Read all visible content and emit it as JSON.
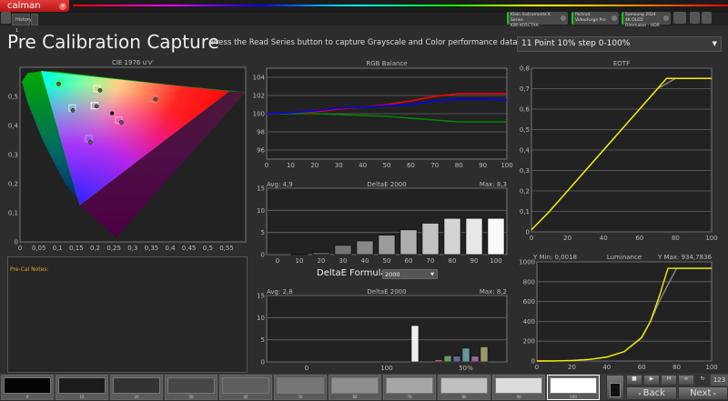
{
  "app": {
    "logo": "calman",
    "history_tab": "History 1"
  },
  "devices": [
    {
      "line1": "Klein Instruments K Series",
      "line2": "K80 K05CTXA"
    },
    {
      "line1": "Portrait VideoForge Pro",
      "line2": ""
    },
    {
      "line1": "Samsung 2024 4K OLED",
      "line2": "Filmmaker - HDR"
    }
  ],
  "page": {
    "title": "Pre Calibration Capture",
    "instruction": "Press the Read Series button to capture Grayscale and Color performance data pre-calibration.",
    "series_select": "11 Point 10% step 0-100%"
  },
  "notes": {
    "label": "Pre-Cal Notes:"
  },
  "deltae_formula": {
    "label": "DeltaE Formula",
    "value": "2000"
  },
  "colors": {
    "accent": "#d42020",
    "yellow": "#f0f000"
  },
  "chart_data": [
    {
      "id": "cie",
      "type": "scatter",
      "title": "CIE 1976 u'v'",
      "xlim": [
        0,
        0.6
      ],
      "ylim": [
        0,
        0.6
      ],
      "xticks": [
        "0",
        "0,05",
        "0,1",
        "0,15",
        "0,2",
        "0,25",
        "0,3",
        "0,35",
        "0,4",
        "0,45",
        "0,5",
        "0,55"
      ],
      "yticks": [
        "0",
        "0,1",
        "0,2",
        "0,3",
        "0,4",
        "0,5"
      ],
      "gamut": {
        "red": [
          0.557,
          0.517
        ],
        "green": [
          0.056,
          0.587
        ],
        "blue": [
          0.159,
          0.126
        ]
      },
      "points": [
        {
          "name": "green",
          "target": [
            0.105,
            0.545
          ],
          "measured": [
            0.103,
            0.543
          ],
          "color": "#44ff44"
        },
        {
          "name": "yellow",
          "target": [
            0.205,
            0.527
          ],
          "measured": [
            0.213,
            0.521
          ],
          "color": "#ffffaa"
        },
        {
          "name": "red",
          "target": [
            0.355,
            0.492
          ],
          "measured": [
            0.361,
            0.49
          ],
          "color": "#ff8888"
        },
        {
          "name": "cyan",
          "target": [
            0.139,
            0.46
          ],
          "measured": [
            0.141,
            0.452
          ],
          "color": "#aaffff"
        },
        {
          "name": "white",
          "target": [
            0.198,
            0.468
          ],
          "measured": [
            0.204,
            0.466
          ],
          "color": "#ffffff"
        },
        {
          "name": "magenta",
          "target": [
            0.263,
            0.418
          ],
          "measured": [
            0.27,
            0.411
          ],
          "color": "#ffaaff"
        },
        {
          "name": "blue",
          "target": [
            0.183,
            0.355
          ],
          "measured": [
            0.187,
            0.343
          ],
          "color": "#aaaaff"
        }
      ],
      "black_point": [
        0.245,
        0.442
      ]
    },
    {
      "id": "rgb",
      "type": "line",
      "title": "RGB Balance",
      "xlim": [
        0,
        100
      ],
      "ylim": [
        95,
        105
      ],
      "x": [
        0,
        10,
        20,
        30,
        40,
        50,
        60,
        70,
        80,
        90,
        100
      ],
      "yticks": [
        "96",
        "98",
        "100",
        "102",
        "104"
      ],
      "series": [
        {
          "color": "#008800",
          "values": [
            100,
            100,
            100,
            99.9,
            99.8,
            99.7,
            99.5,
            99.3,
            99.1,
            99.1,
            99.1
          ]
        },
        {
          "color": "#ff0000",
          "values": [
            100,
            100.1,
            100.2,
            100.5,
            100.7,
            101,
            101.4,
            101.9,
            102.2,
            102.2,
            102.2
          ]
        },
        {
          "color": "#0000ff",
          "values": [
            100,
            100.1,
            100.3,
            100.6,
            100.7,
            100.9,
            101,
            101.4,
            101.6,
            101.6,
            101.5
          ]
        }
      ]
    },
    {
      "id": "de_gray",
      "type": "bar",
      "title": "DeltaE 2000",
      "avg": "Avg: 4,9",
      "max": "Max: 8,3",
      "ylim": [
        0,
        15
      ],
      "categories": [
        "0",
        "10",
        "20",
        "30",
        "40",
        "50",
        "60",
        "70",
        "80",
        "90",
        "100"
      ],
      "values": [
        0,
        0.1,
        0.5,
        2.1,
        3.1,
        4.4,
        5.6,
        7.1,
        8.2,
        8.2,
        8.2
      ],
      "yticks": [
        "0",
        "5",
        "10",
        "15"
      ]
    },
    {
      "id": "de_color",
      "type": "bar",
      "title": "DeltaE 2000",
      "avg": "Avg: 2,8",
      "max": "Max: 8,2",
      "ylim": [
        0,
        15
      ],
      "categories": [
        "0",
        "100",
        "50%"
      ],
      "yticks": [
        "0",
        "5",
        "10",
        "15"
      ],
      "bars": [
        {
          "group": "100",
          "color": "#eeeeee",
          "value": 8.2
        },
        {
          "group": "50%",
          "color": "#aa6677",
          "value": 0.5
        },
        {
          "group": "50%",
          "color": "#669966",
          "value": 1.4
        },
        {
          "group": "50%",
          "color": "#666699",
          "value": 1.3
        },
        {
          "group": "50%",
          "color": "#669999",
          "value": 3.1
        },
        {
          "group": "50%",
          "color": "#996699",
          "value": 1.3
        },
        {
          "group": "50%",
          "color": "#999966",
          "value": 3.4
        }
      ]
    },
    {
      "id": "eotf",
      "type": "line",
      "title": "EOTF",
      "xlim": [
        0,
        100
      ],
      "ylim": [
        0,
        0.8
      ],
      "x": [
        0,
        10,
        20,
        30,
        40,
        50,
        60,
        70,
        75,
        80,
        90,
        100
      ],
      "xticks": [
        "0",
        "20",
        "40",
        "60",
        "80",
        "100"
      ],
      "yticks": [
        "0",
        "0,1",
        "0,2",
        "0,3",
        "0,4",
        "0,5",
        "0,6",
        "0,7",
        "0,8"
      ],
      "series": [
        {
          "color": "#888888",
          "values": [
            0.01,
            0.1,
            0.2,
            0.3,
            0.4,
            0.5,
            0.6,
            0.7,
            0.725,
            0.75,
            0.75,
            0.75
          ]
        },
        {
          "color": "#f0f000",
          "values": [
            0.01,
            0.1,
            0.2,
            0.3,
            0.4,
            0.5,
            0.6,
            0.7,
            0.75,
            0.75,
            0.75,
            0.75
          ]
        }
      ]
    },
    {
      "id": "lum",
      "type": "line",
      "title": "Luminance",
      "ymin_label": "Y Min: 0,0018",
      "ymax_label": "Y Max: 934,7836",
      "xlim": [
        0,
        100
      ],
      "ylim": [
        0,
        1000
      ],
      "x": [
        0,
        10,
        20,
        30,
        40,
        50,
        60,
        65,
        70,
        75,
        80,
        90,
        100
      ],
      "xticks": [
        "0",
        "20",
        "40",
        "60",
        "80",
        "100"
      ],
      "yticks": [
        "0",
        "200",
        "400",
        "600",
        "800",
        "1000"
      ],
      "series": [
        {
          "color": "#888888",
          "values": [
            0,
            1,
            5,
            15,
            40,
            95,
            240,
            400,
            600,
            770,
            935,
            935,
            935
          ]
        },
        {
          "color": "#f0f000",
          "values": [
            0,
            1,
            5,
            15,
            40,
            95,
            235,
            400,
            650,
            935,
            935,
            935,
            935
          ]
        }
      ]
    }
  ],
  "swatches": [
    {
      "label": "0",
      "color": "#050505"
    },
    {
      "label": "10",
      "color": "#1c1c1c"
    },
    {
      "label": "20",
      "color": "#333"
    },
    {
      "label": "30",
      "color": "#474747"
    },
    {
      "label": "40",
      "color": "#5e5e5e"
    },
    {
      "label": "50",
      "color": "#767676"
    },
    {
      "label": "60",
      "color": "#8e8e8e"
    },
    {
      "label": "70",
      "color": "#a6a6a6"
    },
    {
      "label": "80",
      "color": "#c0c0c0"
    },
    {
      "label": "90",
      "color": "#dcdcdc"
    },
    {
      "label": "100",
      "color": "#ffffff"
    }
  ],
  "nav": {
    "back": "Back",
    "next": "Next",
    "counter": "123"
  }
}
